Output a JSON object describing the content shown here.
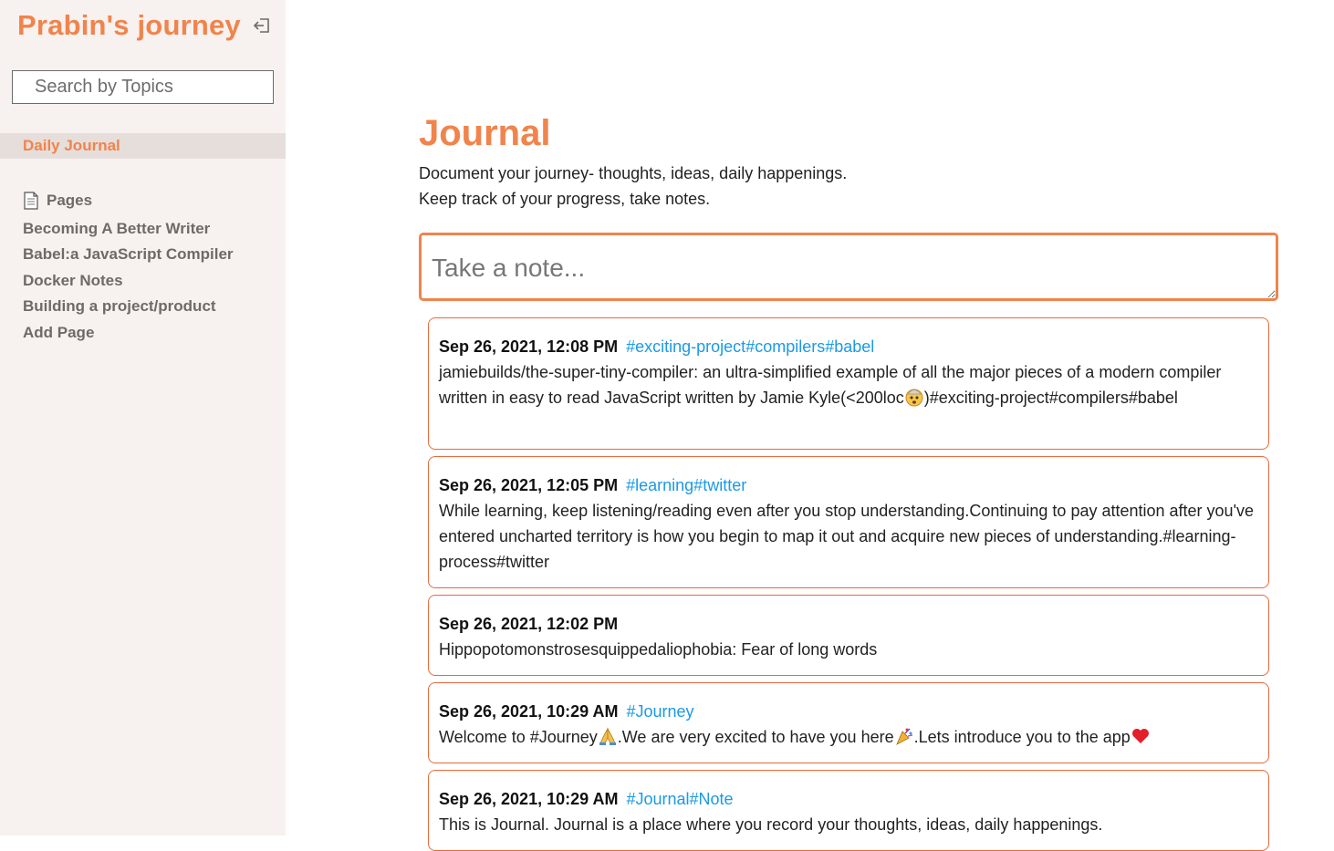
{
  "app": {
    "title": "Prabin's journey"
  },
  "sidebar": {
    "search_placeholder": "Search by Topics",
    "active_item": "Daily Journal",
    "pages_heading": "Pages",
    "pages": [
      "Becoming A Better Writer",
      "Babel:a JavaScript Compiler",
      "Docker Notes",
      "Building a project/product",
      "Add Page"
    ]
  },
  "main": {
    "title": "Journal",
    "description_line1": "Document your journey- thoughts, ideas, daily happenings.",
    "description_line2": "Keep track of your progress, take notes.",
    "note_placeholder": "Take a note..."
  },
  "notes": [
    {
      "time": "Sep 26, 2021, 12:08 PM",
      "tags": "#exciting-project#compilers#babel",
      "text_before": "jamiebuilds/the-super-tiny-compiler: an ultra-simplified example of all the major pieces of a modern compiler written in easy to read JavaScript written by Jamie Kyle(<200loc",
      "text_after": ")#exciting-project#compilers#babel"
    },
    {
      "time": "Sep 26, 2021, 12:05 PM",
      "tags": "#learning#twitter",
      "text": "While learning, keep listening/reading even after you stop understanding.Continuing to pay attention after you've entered uncharted territory is how you begin to map it out and acquire new pieces of understanding.#learning-process#twitter"
    },
    {
      "time": "Sep 26, 2021, 12:02 PM",
      "tags": "",
      "text": "Hippopotomonstrosesquippedaliophobia: Fear of long words"
    },
    {
      "time": "Sep 26, 2021, 10:29 AM",
      "tags": "#Journey",
      "text_part1": "Welcome to #Journey",
      "text_part2": ".We are very excited to have you here",
      "text_part3": ".Lets introduce you to the app"
    },
    {
      "time": "Sep 26, 2021, 10:29 AM",
      "tags": "#Journal#Note",
      "text": "This is Journal. Journal is a place where you record your thoughts, ideas, daily happenings."
    }
  ],
  "colors": {
    "accent": "#f0844c",
    "tag": "#1a9ae6",
    "sidebar_bg": "#f7f1ef",
    "card_border": "#ea6a3a"
  }
}
